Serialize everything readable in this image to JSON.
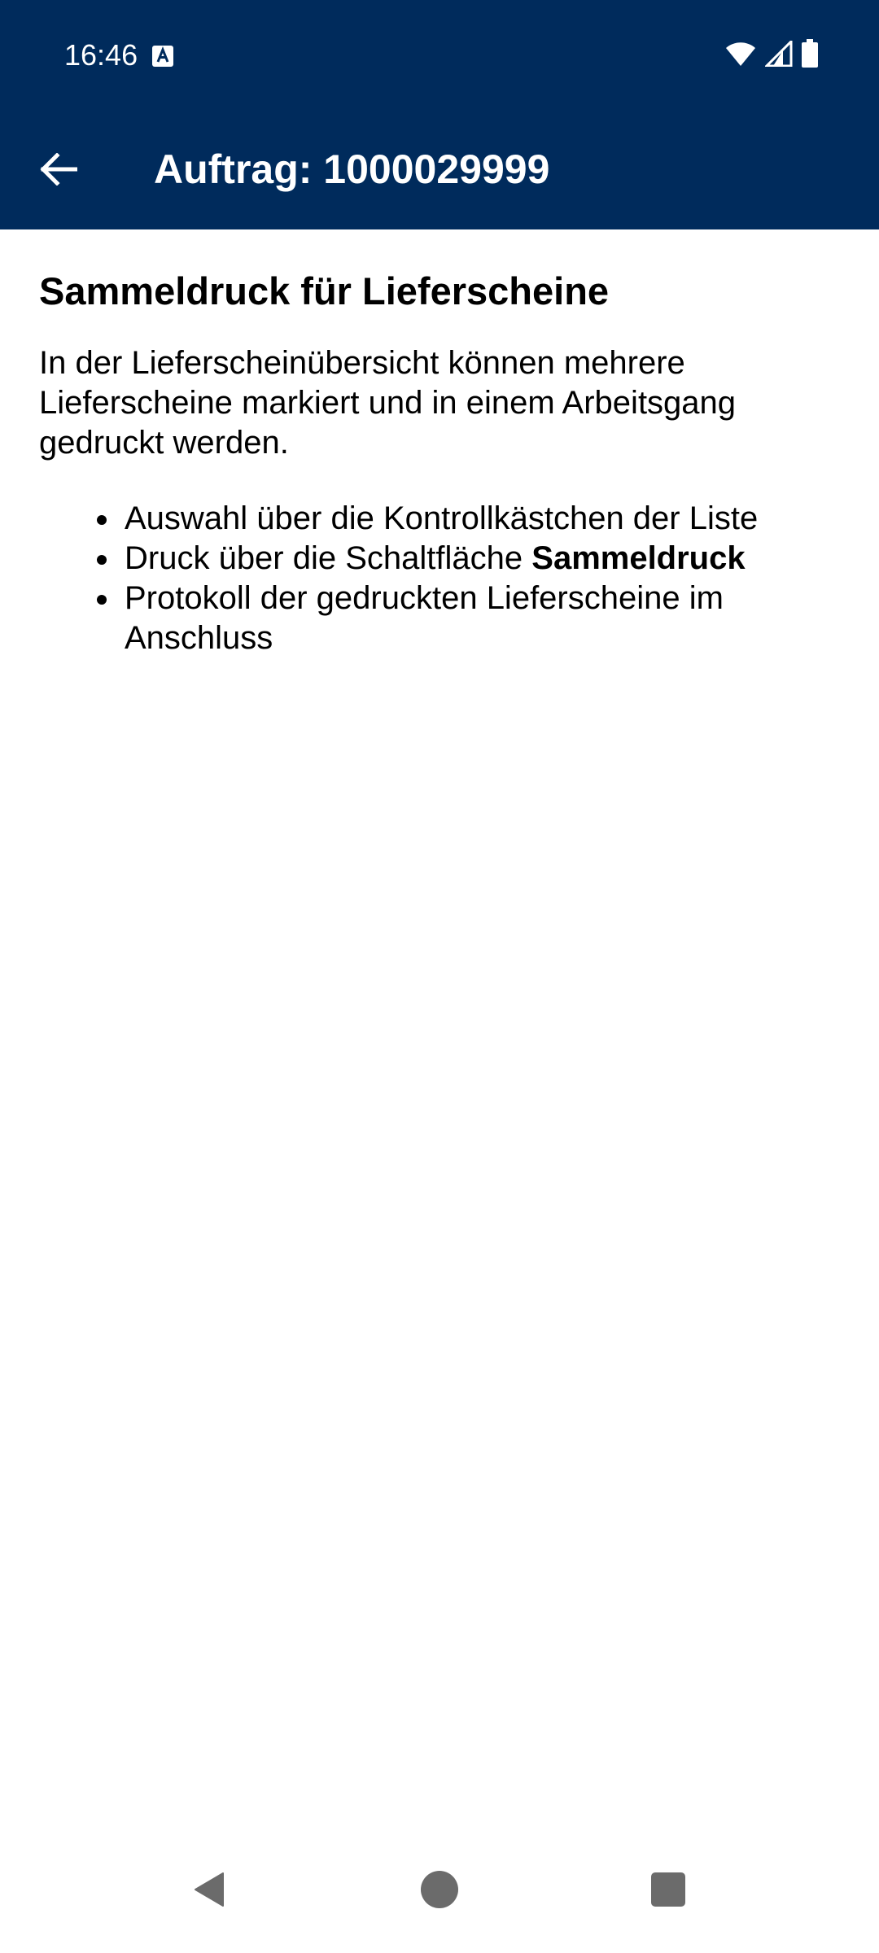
{
  "status_bar": {
    "time": "16:46",
    "icons": [
      "keyboard-a-icon",
      "wifi-icon",
      "signal-icon",
      "battery-icon"
    ]
  },
  "app_bar": {
    "title": "Auftrag: 1000029999",
    "back_icon": "arrow-left-icon"
  },
  "content": {
    "title": "Sammeldruck für Lieferscheine",
    "intro": "In der Lieferscheinübersicht können mehrere Lieferscheine markiert und in einem Arbeitsgang gedruckt werden.",
    "bullets": [
      {
        "text": "Auswahl über die Kontrollkästchen der Liste"
      },
      {
        "text": "Druck über die Schaltfläche ",
        "bold": "Sammeldruck"
      },
      {
        "text": "Protokoll der gedruckten Lieferscheine im Anschluss"
      }
    ]
  },
  "nav_bar": {
    "icons": [
      "nav-back-icon",
      "nav-home-icon",
      "nav-recents-icon"
    ]
  },
  "colors": {
    "header_bg": "#002b5c",
    "header_text": "#ffffff",
    "body_text": "#000000",
    "nav_icon": "#6b6b6b"
  }
}
